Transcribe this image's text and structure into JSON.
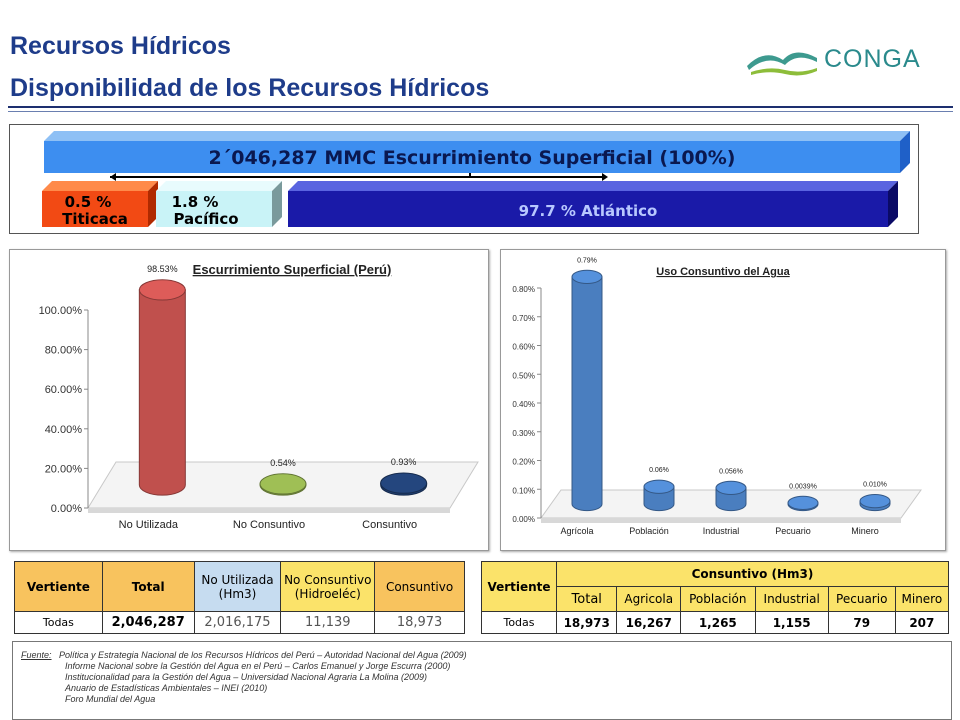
{
  "header": {
    "title_line1": "Recursos Hídricos",
    "title_line2": "Disponibilidad de los Recursos Hídricos",
    "logo_text": "CONGA"
  },
  "summary": {
    "total_label": "2´046,287 MMC Escurrimiento Superficial (100%)",
    "titicaca_line1": "0.5 %",
    "titicaca_line2": "Titicaca",
    "pacifico_line1": "1.8 %",
    "pacifico_line2": "Pacífico",
    "atlantico": "97.7 % Atlántico"
  },
  "chart_data": [
    {
      "type": "bar",
      "title": "Escurrimiento Superficial (Perú)",
      "categories": [
        "No Utilizada",
        "No Consuntivo",
        "Consuntivo"
      ],
      "values": [
        98.53,
        0.54,
        0.93
      ],
      "value_labels": [
        "98.53%",
        "0.54%",
        "0.93%"
      ],
      "colors": [
        "#c0504d",
        "#8aa64a",
        "#1f3d6e"
      ],
      "ylim": [
        0,
        100
      ],
      "yticks": [
        "0.00%",
        "20.00%",
        "40.00%",
        "60.00%",
        "80.00%",
        "100.00%"
      ],
      "ytick_values": [
        0,
        20,
        40,
        60,
        80,
        100
      ]
    },
    {
      "type": "bar",
      "title": "Uso Consuntivo del Agua",
      "categories": [
        "Agrícola",
        "Población",
        "Industrial",
        "Pecuario",
        "Minero"
      ],
      "values": [
        0.79,
        0.06,
        0.056,
        0.0039,
        0.01
      ],
      "value_labels": [
        "0.79%",
        "0.06%",
        "0.056%",
        "0.0039%",
        "0.010%"
      ],
      "colors": [
        "#4a7ebf",
        "#4a7ebf",
        "#4a7ebf",
        "#4a7ebf",
        "#4a7ebf"
      ],
      "ylim": [
        0,
        0.8
      ],
      "yticks": [
        "0.00%",
        "0.10%",
        "0.20%",
        "0.30%",
        "0.40%",
        "0.50%",
        "0.60%",
        "0.70%",
        "0.80%"
      ],
      "ytick_values": [
        0,
        0.1,
        0.2,
        0.3,
        0.4,
        0.5,
        0.6,
        0.7,
        0.8
      ]
    }
  ],
  "table1": {
    "h_vertiente": "Vertiente",
    "h_total": "Total",
    "h_nu1": "No Utilizada",
    "h_nu2": "(Hm3)",
    "h_nc1": "No Consuntivo",
    "h_nc2": "(Hidroeléc)",
    "h_cons": "Consuntivo",
    "r_vertiente": "Todas",
    "r_total": "2,046,287",
    "r_nu": "2,016,175",
    "r_nc": "11,139",
    "r_cons": "18,973"
  },
  "table2": {
    "h_vertiente": "Vertiente",
    "h_group": "Consuntivo (Hm3)",
    "h_total": "Total",
    "h_agricola": "Agricola",
    "h_poblacion": "Población",
    "h_industrial": "Industrial",
    "h_pecuario": "Pecuario",
    "h_minero": "Minero",
    "r_vertiente": "Todas",
    "r_total": "18,973",
    "r_agricola": "16,267",
    "r_poblacion": "1,265",
    "r_industrial": "1,155",
    "r_pecuario": "79",
    "r_minero": "207"
  },
  "sources": {
    "label": "Fuente:",
    "s1": "Política y Estrategia Nacional de los Recursos Hídricos del Perú – Autoridad Nacional del Agua (2009)",
    "s2": "Informe Nacional sobre la Gestión del Agua en el Perú – Carlos Emanuel y Jorge Escurra (2000)",
    "s3": "Institucionalidad para la Gestión del Agua – Universidad Nacional Agraria La Molina (2009)",
    "s4": "Anuario de Estadísticas Ambientales – INEI (2010)",
    "s5": "Foro Mundial del Agua"
  }
}
